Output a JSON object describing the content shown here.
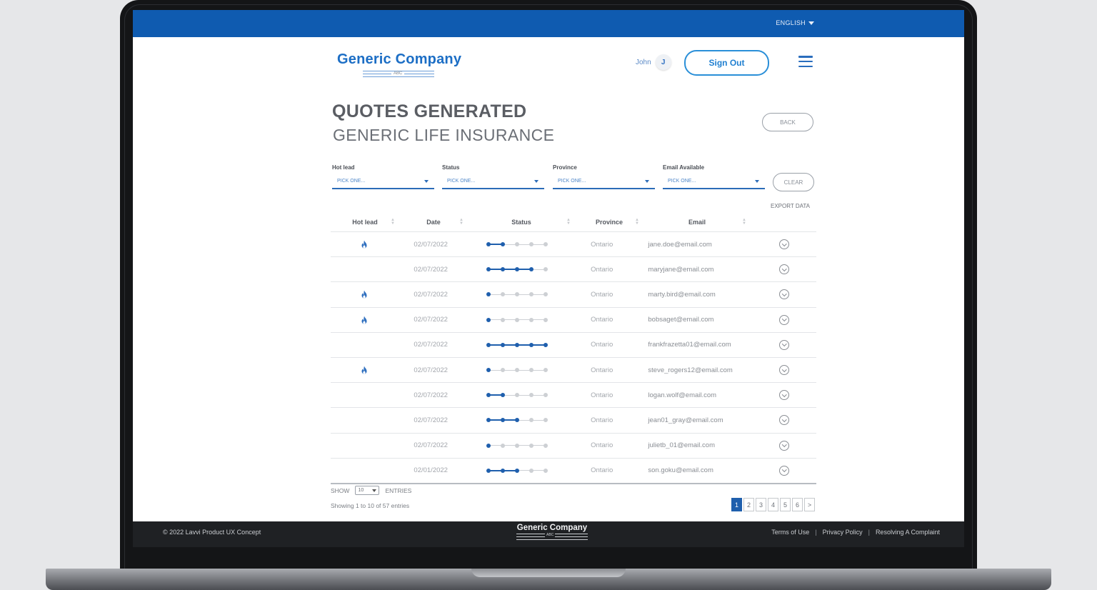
{
  "topbar": {
    "language": "ENGLISH"
  },
  "header": {
    "logo_name": "Generic Company",
    "logo_sub": "ABC",
    "user_name": "John",
    "user_initial": "J",
    "sign_out_label": "Sign Out"
  },
  "page": {
    "title": "QUOTES GENERATED",
    "subtitle": "GENERIC LIFE INSURANCE",
    "back_label": "BACK",
    "clear_label": "CLEAR",
    "export_label": "EXPORT DATA"
  },
  "filters": [
    {
      "label": "Hot lead",
      "value": "PICK ONE..."
    },
    {
      "label": "Status",
      "value": "PICK ONE..."
    },
    {
      "label": "Province",
      "value": "PICK ONE..."
    },
    {
      "label": "Email Available",
      "value": "PICK ONE..."
    }
  ],
  "table": {
    "columns": [
      "Hot lead",
      "Date",
      "Status",
      "Province",
      "Email"
    ],
    "status_steps": 5,
    "rows": [
      {
        "hot": true,
        "date": "02/07/2022",
        "status": 2,
        "province": "Ontario",
        "email": "jane.doe@email.com"
      },
      {
        "hot": false,
        "date": "02/07/2022",
        "status": 4,
        "province": "Ontario",
        "email": "maryjane@email.com"
      },
      {
        "hot": true,
        "date": "02/07/2022",
        "status": 1,
        "province": "Ontario",
        "email": "marty.bird@email.com"
      },
      {
        "hot": true,
        "date": "02/07/2022",
        "status": 1,
        "province": "Ontario",
        "email": "bobsaget@email.com"
      },
      {
        "hot": false,
        "date": "02/07/2022",
        "status": 5,
        "province": "Ontario",
        "email": "frankfrazetta01@email.com"
      },
      {
        "hot": true,
        "date": "02/07/2022",
        "status": 1,
        "province": "Ontario",
        "email": "steve_rogers12@email.com"
      },
      {
        "hot": false,
        "date": "02/07/2022",
        "status": 2,
        "province": "Ontario",
        "email": "logan.wolf@email.com"
      },
      {
        "hot": false,
        "date": "02/07/2022",
        "status": 3,
        "province": "Ontario",
        "email": "jean01_gray@email.com"
      },
      {
        "hot": false,
        "date": "02/07/2022",
        "status": 1,
        "province": "Ontario",
        "email": "julietb_01@email.com"
      },
      {
        "hot": false,
        "date": "02/01/2022",
        "status": 3,
        "province": "Ontario",
        "email": "son.goku@email.com"
      }
    ]
  },
  "entries": {
    "show_label": "SHOW",
    "count": "10",
    "entries_label": "ENTRIES",
    "summary": "Showing 1 to 10 of 57 entries"
  },
  "pagination": {
    "pages": [
      "1",
      "2",
      "3",
      "4",
      "5",
      "6"
    ],
    "active": "1",
    "next": ">"
  },
  "footer": {
    "copyright": "© 2022 Lavvi Product UX Concept",
    "logo_name": "Generic Company",
    "logo_sub": "ABC",
    "links": [
      "Terms of Use",
      "Privacy Policy",
      "Resolving A Complaint"
    ]
  },
  "colors": {
    "brand_blue": "#0f5bb0",
    "accent": "#1f5fad",
    "footer_bg": "#1f2124"
  }
}
